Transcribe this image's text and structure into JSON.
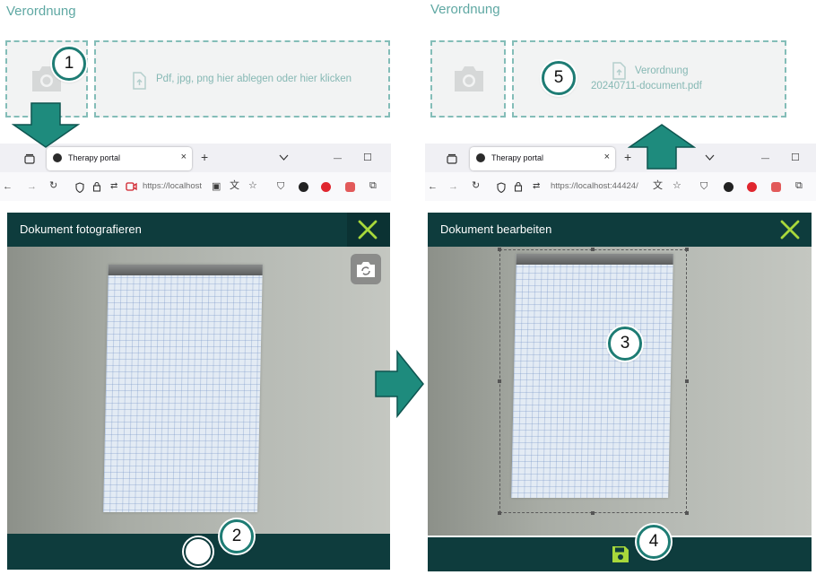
{
  "left": {
    "section_title": "Verordnung",
    "dropzone_text": "Pdf, jpg, png hier ablegen oder hier klicken",
    "modal_title": "Dokument fotografieren",
    "url": "https://localhost"
  },
  "right": {
    "section_title": "Verordnung",
    "file_label": "Verordnung",
    "file_name": "20240711-document.pdf",
    "modal_title": "Dokument bearbeiten",
    "url": "https://localhost:44424/"
  },
  "browser": {
    "tab_title": "Therapy portal",
    "new_tab": "+",
    "tab_close": "×",
    "minimize": "—",
    "maximize": "☐"
  },
  "badges": {
    "b1": "1",
    "b2": "2",
    "b3": "3",
    "b4": "4",
    "b5": "5"
  },
  "colors": {
    "teal_dark": "#0e3c3d",
    "teal_arrow": "#1e8b7d",
    "accent_green": "#a8d83b",
    "dashed": "#84bdb8"
  },
  "icons": [
    "camera-icon",
    "upload-file-icon",
    "close-icon",
    "camera-switch-icon",
    "shutter-button",
    "save-icon",
    "arrow-down",
    "arrow-right",
    "arrow-up"
  ]
}
